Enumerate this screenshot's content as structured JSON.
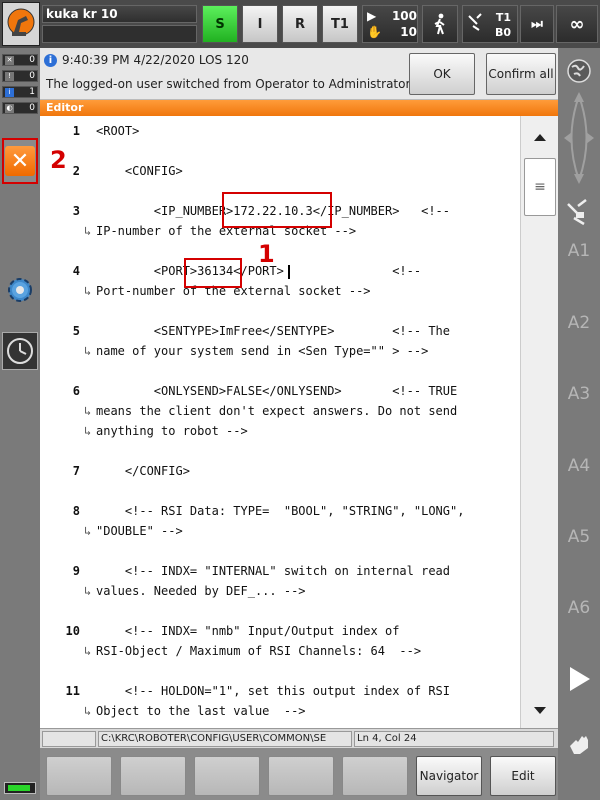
{
  "top_bar": {
    "robot_name": "kuka kr 10",
    "mode_s": "S",
    "mode_i": "I",
    "mode_r": "R",
    "mode_t1": "T1",
    "override_program": "100",
    "override_jog": "10",
    "tool": "T1",
    "base": "B0",
    "increment": "∞"
  },
  "message_counters": [
    {
      "icon": "x-icon",
      "count": "0"
    },
    {
      "icon": "warning-icon",
      "count": "0"
    },
    {
      "icon": "info-icon",
      "count": "1"
    },
    {
      "icon": "wait-icon",
      "count": "0"
    }
  ],
  "message": {
    "time": "9:40:39 PM 4/22/2020 LOS 120",
    "text": "The logged-on user switched from Operator to Administrator.",
    "ok_label": "OK",
    "confirm_all_label": "Confirm all"
  },
  "editor": {
    "title": "Editor",
    "lines": [
      {
        "num": "1",
        "text": "<ROOT>",
        "cont": []
      },
      {
        "num": "2",
        "text": "    <CONFIG>",
        "cont": []
      },
      {
        "num": "3",
        "text": "        <IP_NUMBER>172.22.10.3</IP_NUMBER>   <!--",
        "cont": [
          "IP-number of the external socket -->"
        ]
      },
      {
        "num": "4",
        "text": "        <PORT>36134</PORT>               <!--",
        "cont": [
          "Port-number of the external socket -->"
        ]
      },
      {
        "num": "5",
        "text": "        <SENTYPE>ImFree</SENTYPE>        <!-- The",
        "cont": [
          "name of your system send in <Sen Type=\"\" > -->"
        ]
      },
      {
        "num": "6",
        "text": "        <ONLYSEND>FALSE</ONLYSEND>       <!-- TRUE",
        "cont": [
          "means the client don't expect answers. Do not send",
          "anything to robot -->"
        ]
      },
      {
        "num": "7",
        "text": "    </CONFIG>",
        "cont": []
      },
      {
        "num": "8",
        "text": "    <!-- RSI Data: TYPE=  \"BOOL\", \"STRING\", \"LONG\",",
        "cont": [
          "\"DOUBLE\" -->"
        ]
      },
      {
        "num": "9",
        "text": "    <!-- INDX= \"INTERNAL\" switch on internal read",
        "cont": [
          "values. Needed by DEF_... -->"
        ]
      },
      {
        "num": "10",
        "text": "    <!-- INDX= \"nmb\" Input/Output index of",
        "cont": [
          "RSI-Object / Maximum of RSI Channels: 64  -->"
        ]
      },
      {
        "num": "11",
        "text": "    <!-- HOLDON=\"1\", set this output index of RSI",
        "cont": [
          "Object to the last value  -->"
        ]
      }
    ],
    "annotation_1": "1",
    "annotation_2": "2"
  },
  "status_bar": {
    "path": "C:\\KRC\\ROBOTER\\CONFIG\\USER\\COMMON\\SE",
    "position": "Ln 4, Col 24"
  },
  "softkeys": {
    "navigator_label": "Navigator",
    "edit_label": "Edit"
  },
  "right_bar": {
    "axes": [
      "A1",
      "A2",
      "A3",
      "A4",
      "A5",
      "A6"
    ]
  },
  "colors": {
    "accent_orange": "#f0760c",
    "highlight_red": "#d40000",
    "active_green": "#21b121"
  }
}
